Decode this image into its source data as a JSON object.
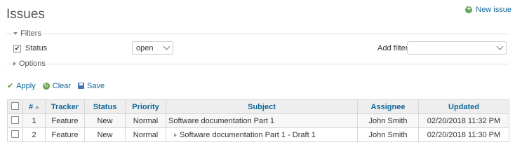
{
  "page": {
    "title": "Issues",
    "new_issue_label": "New issue"
  },
  "filters": {
    "legend": "Filters",
    "status": {
      "label": "Status",
      "checked": true,
      "operator": "open"
    },
    "add_filter_label": "Add filter",
    "add_filter_value": ""
  },
  "options": {
    "legend": "Options"
  },
  "actions": {
    "apply": "Apply",
    "clear": "Clear",
    "save": "Save"
  },
  "table": {
    "columns": [
      "#",
      "Tracker",
      "Status",
      "Priority",
      "Subject",
      "Assignee",
      "Updated"
    ],
    "rows": [
      {
        "id": "1",
        "tracker": "Feature",
        "status": "New",
        "priority": "Normal",
        "subject": "Software documentation Part 1",
        "assignee": "John Smith",
        "updated": "02/20/2018 11:32 PM",
        "child": false
      },
      {
        "id": "2",
        "tracker": "Feature",
        "status": "New",
        "priority": "Normal",
        "subject": "Software documentation Part 1 - Draft 1",
        "assignee": "John Smith",
        "updated": "02/20/2018 11:30 PM",
        "child": true
      }
    ]
  },
  "colors": {
    "link": "#116699",
    "header_bg": "#eeeeee",
    "border": "#d7d7d7",
    "apply_icon": "#5a9a3a"
  }
}
